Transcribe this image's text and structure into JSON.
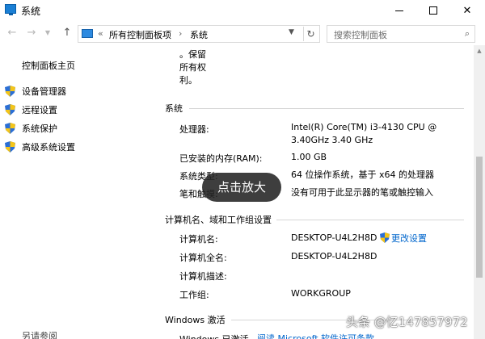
{
  "window": {
    "title": "系统"
  },
  "address": {
    "root_sep": "«",
    "crumbs": [
      "所有控制面板项",
      "系统"
    ],
    "crumb_sep": "›"
  },
  "search": {
    "placeholder": "搜索控制面板"
  },
  "sidebar": {
    "home": "控制面板主页",
    "items": [
      {
        "label": "设备管理器",
        "icon": "shield-icon"
      },
      {
        "label": "远程设置",
        "icon": "shield-icon"
      },
      {
        "label": "系统保护",
        "icon": "shield-icon"
      },
      {
        "label": "高级系统设置",
        "icon": "shield-icon"
      }
    ],
    "see_also": "另请参阅"
  },
  "main": {
    "copyright_lines": [
      "。保留",
      "所有权",
      "利。"
    ],
    "system": {
      "heading": "系统",
      "rows": [
        {
          "label": "处理器:",
          "value": "Intel(R) Core(TM) i3-4130 CPU @",
          "value2": "3.40GHz   3.40 GHz"
        },
        {
          "label": "已安装的内存(RAM):",
          "value": "1.00 GB"
        },
        {
          "label": "系统类型:",
          "value": "64 位操作系统，基于 x64 的处理器"
        },
        {
          "label": "笔和触摸:",
          "value": "没有可用于此显示器的笔或触控输入"
        }
      ]
    },
    "computer": {
      "heading": "计算机名、域和工作组设置",
      "rows": [
        {
          "label": "计算机名:",
          "value": "DESKTOP-U4L2H8D"
        },
        {
          "label": "计算机全名:",
          "value": "DESKTOP-U4L2H8D"
        },
        {
          "label": "计算机描述:",
          "value": ""
        },
        {
          "label": "工作组:",
          "value": "WORKGROUP"
        }
      ],
      "change_link": "更改设置"
    },
    "activation": {
      "heading": "Windows 激活",
      "status": "Windows 已激活",
      "link": "阅读 Microsoft 软件许可条款"
    }
  },
  "overlay": {
    "zoom_label": "点击放大"
  },
  "watermark": "头条 @忆147857972",
  "colors": {
    "link": "#0066cc",
    "shield_blue": "#2b6fd6",
    "shield_yellow": "#f5c518"
  }
}
